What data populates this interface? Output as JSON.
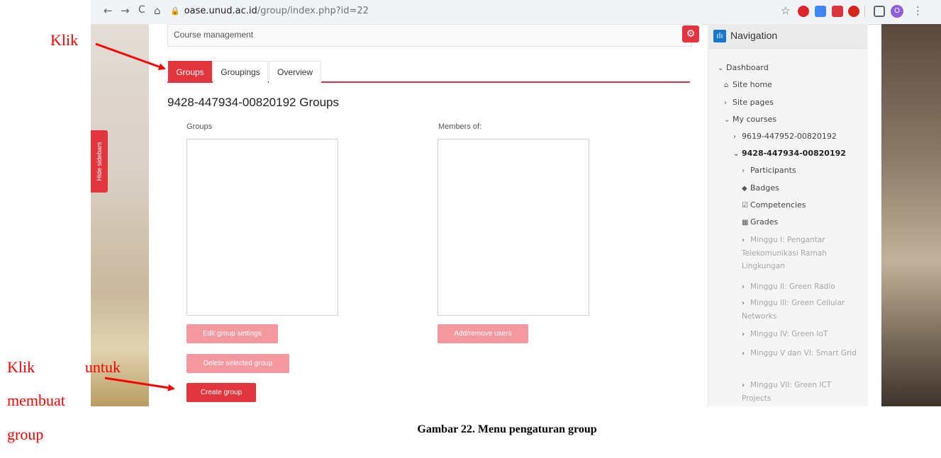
{
  "browser": {
    "back": "←",
    "forward": "→",
    "reload": "C",
    "home": "⌂",
    "lock": "🔒",
    "url_host": "oase.unud.ac.id",
    "url_path": "/group/index.php?id=22",
    "star": "☆",
    "menu": "⋮",
    "profile_initial": "O"
  },
  "sidebar_toggle": {
    "label": "Hide sidebars"
  },
  "course_management": {
    "label": "Course management",
    "gear": "⚙"
  },
  "tabs": [
    {
      "label": "Groups",
      "active": true
    },
    {
      "label": "Groupings",
      "active": false
    },
    {
      "label": "Overview",
      "active": false
    }
  ],
  "page_title": "9428-447934-00820192 Groups",
  "groups_column": {
    "label": "Groups"
  },
  "members_column": {
    "label": "Members of:"
  },
  "buttons": {
    "edit_group_settings": "Edit group settings",
    "delete_selected_group": "Delete selected group",
    "create_group": "Create group",
    "add_remove_users": "Add/remove users"
  },
  "navigation": {
    "title": "Navigation",
    "icon": "ılı",
    "items": [
      {
        "label": "Dashboard",
        "icon": "⌄"
      },
      {
        "label": "Site home",
        "icon": "⌂"
      },
      {
        "label": "Site pages",
        "icon": "›"
      },
      {
        "label": "My courses",
        "icon": "⌄"
      },
      {
        "label": "9619-447952-00820192",
        "icon": "›"
      },
      {
        "label": "9428-447934-00820192",
        "icon": "⌄"
      },
      {
        "label": "Participants",
        "icon": "›"
      },
      {
        "label": "Badges",
        "icon": "◆"
      },
      {
        "label": "Competencies",
        "icon": "☑"
      },
      {
        "label": "Grades",
        "icon": "▦"
      },
      {
        "label": "Minggu I: Pengantar Telekomunikasi Ramah Lingkungan",
        "icon": "›"
      },
      {
        "label": "Minggu II: Green Radio",
        "icon": "›"
      },
      {
        "label": "Minggu III: Green Cellular Networks",
        "icon": "›"
      },
      {
        "label": "Minggu IV: Green IoT",
        "icon": "›"
      },
      {
        "label": "Minggu V dan VI: Smart Grid",
        "icon": "›"
      },
      {
        "label": "Minggu VII: Green ICT Projects",
        "icon": "›"
      }
    ]
  },
  "annotations": {
    "klik": "Klik",
    "klik_untuk": "Klik untuk",
    "membuat": "membuat",
    "group": "group"
  },
  "caption": "Gambar 22. Menu pengaturan group",
  "colors": {
    "accent": "#e2353d",
    "button_disabled": "#f2989e",
    "nav_icon": "#1877c9",
    "annotation": "#ff0000"
  }
}
